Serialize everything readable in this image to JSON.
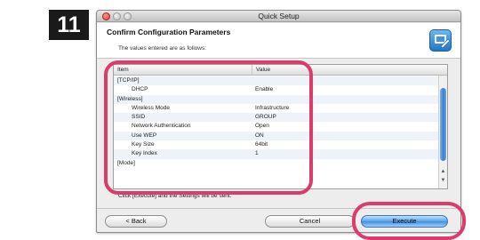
{
  "step_number": "11",
  "window": {
    "title": "Quick Setup"
  },
  "header": {
    "title": "Confirm Configuration Parameters",
    "subtitle": "The values entered are as follows:",
    "icon": "setup-tool-icon"
  },
  "table": {
    "columns": {
      "item": "Item",
      "value": "Value"
    },
    "rows": [
      {
        "item": "[TCP/IP]",
        "value": "",
        "child": false
      },
      {
        "item": "DHCP",
        "value": "Enable",
        "child": true
      },
      {
        "item": "[Wireless]",
        "value": "",
        "child": false
      },
      {
        "item": "Wireless Mode",
        "value": "Infrastructure",
        "child": true
      },
      {
        "item": "SSID",
        "value": "GROUP",
        "child": true
      },
      {
        "item": "Network Authentication",
        "value": "Open",
        "child": true
      },
      {
        "item": "Use WEP",
        "value": "ON",
        "child": true
      },
      {
        "item": "Key Size",
        "value": "64bit",
        "child": true
      },
      {
        "item": "Key Index",
        "value": "1",
        "child": true
      },
      {
        "item": "[Mode]",
        "value": "",
        "child": false
      }
    ]
  },
  "footer_text": "Click [Execute] and the Settings will be sent.",
  "buttons": {
    "back": "< Back",
    "cancel": "Cancel",
    "execute": "Execute"
  },
  "colors": {
    "highlight": "#dd3b6c",
    "execute_button": "#3d8fe0"
  }
}
